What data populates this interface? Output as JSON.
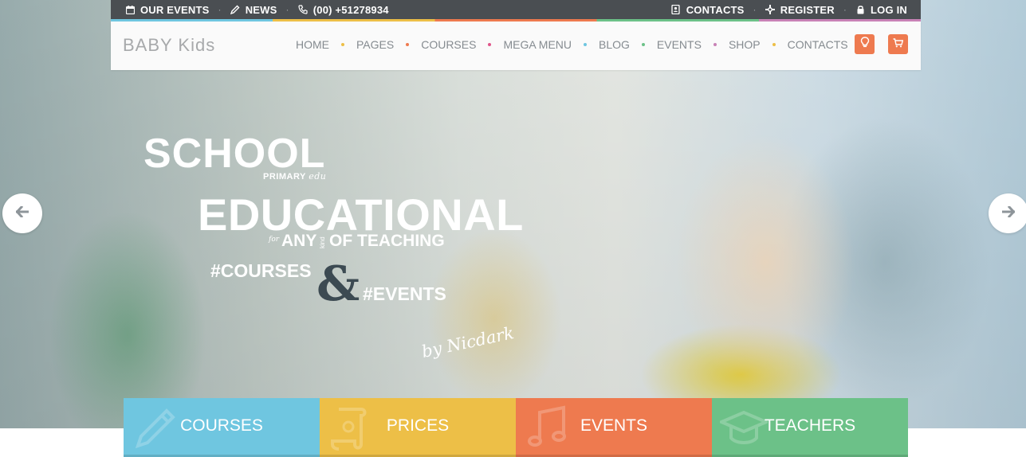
{
  "topbar": {
    "left": [
      {
        "label": "OUR EVENTS",
        "icon": "calendar-icon"
      },
      {
        "label": "NEWS",
        "icon": "pencil-icon"
      },
      {
        "label": "(00) +51278934",
        "icon": "phone-icon"
      }
    ],
    "right": [
      {
        "label": "CONTACTS",
        "icon": "address-book-icon"
      },
      {
        "label": "REGISTER",
        "icon": "plus-cross-icon"
      },
      {
        "label": "LOG IN",
        "icon": "lock-icon"
      }
    ]
  },
  "brand": {
    "logo_text": "BABY Kids"
  },
  "nav": {
    "items": [
      {
        "label": "HOME",
        "dot_color": "#edbf47"
      },
      {
        "label": "PAGES",
        "dot_color": "#ee7a4f"
      },
      {
        "label": "COURSES",
        "dot_color": "#e0558a"
      },
      {
        "label": "MEGA MENU",
        "dot_color": "#6fc6e0"
      },
      {
        "label": "BLOG",
        "dot_color": "#6cc188"
      },
      {
        "label": "EVENTS",
        "dot_color": "#c882b6"
      },
      {
        "label": "SHOP",
        "dot_color": "#edbf47"
      },
      {
        "label": "CONTACTS",
        "dot_color": null
      }
    ],
    "buttons": [
      "lightbulb-icon",
      "cart-icon"
    ]
  },
  "hero": {
    "line1": "SCHOOL",
    "line1_sub_a": "PRIMARY",
    "line1_sub_b": "edu",
    "line2": "EDUCATIONAL",
    "for_word": "for",
    "any_word": "ANY",
    "kind_word": "kind",
    "of_teaching": "OF TEACHING",
    "courses_tag": "#COURSES",
    "ampersand": "&",
    "events_tag": "#EVENTS",
    "signature": "by Nicdark"
  },
  "slider": {
    "prev_icon": "arrow-left-icon",
    "next_icon": "arrow-right-icon"
  },
  "tiles": [
    {
      "label": "COURSES",
      "color": "#6fc6e0",
      "icon": "pencil-icon"
    },
    {
      "label": "PRICES",
      "color": "#edbf47",
      "icon": "scroll-icon"
    },
    {
      "label": "EVENTS",
      "color": "#ee7a4f",
      "icon": "music-note-icon"
    },
    {
      "label": "TEACHERS",
      "color": "#6cc188",
      "icon": "graduation-cap-icon"
    }
  ],
  "colors": {
    "topbar_bg": "#4a4e52",
    "accent_orange": "#ee7a4f"
  }
}
